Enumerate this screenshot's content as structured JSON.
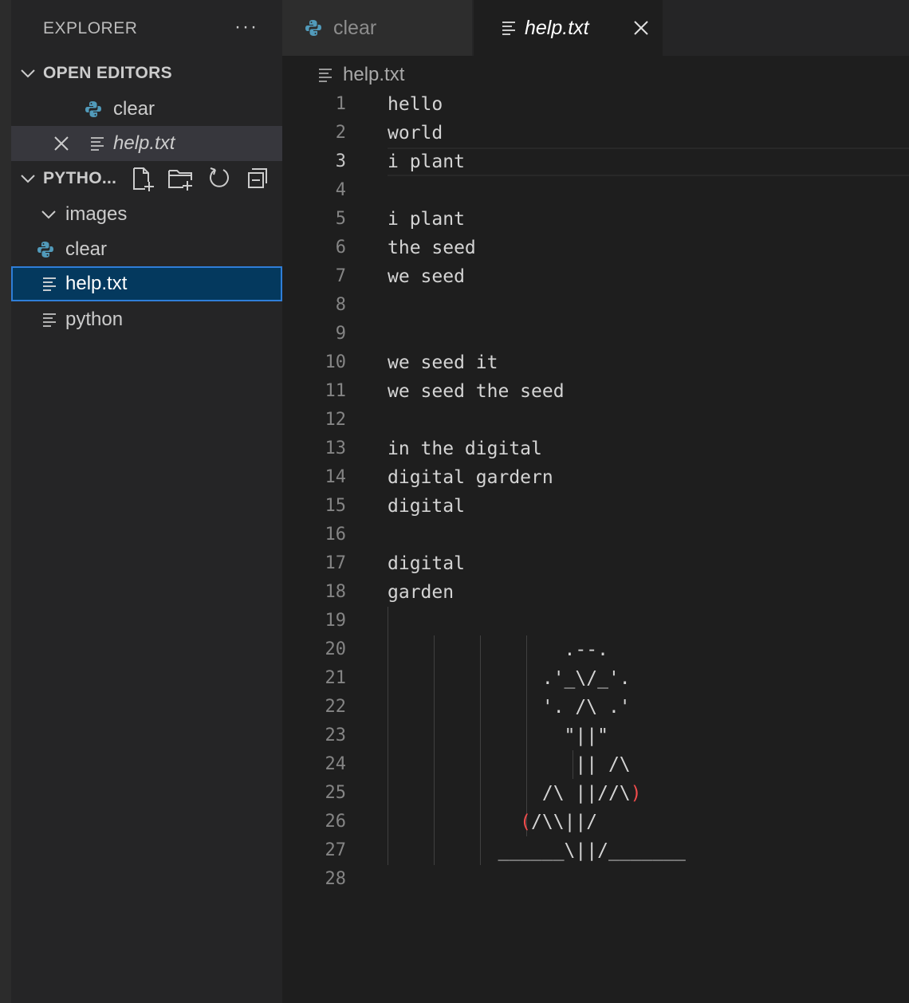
{
  "sidebar": {
    "title": "EXPLORER",
    "more_label": "···",
    "open_editors": {
      "title": "OPEN EDITORS",
      "items": [
        {
          "label": "clear",
          "icon": "python-icon"
        },
        {
          "label": "help.txt",
          "icon": "text-file-icon"
        }
      ]
    },
    "project": {
      "title": "PYTHO...",
      "items": [
        {
          "label": "images",
          "icon": "chevron-down-icon"
        },
        {
          "label": "clear",
          "icon": "python-icon"
        },
        {
          "label": "help.txt",
          "icon": "text-file-icon"
        },
        {
          "label": "python",
          "icon": "text-file-icon"
        }
      ]
    }
  },
  "tabs": [
    {
      "label": "clear",
      "icon": "python-icon",
      "active": false
    },
    {
      "label": "help.txt",
      "icon": "text-file-icon",
      "active": true
    }
  ],
  "breadcrumb": "help.txt",
  "colors": {
    "python_icon": "#519aba",
    "selection_bg": "#04395e",
    "selection_border": "#2f7ed8",
    "bracket_red": "#f14c4c"
  },
  "editor": {
    "current_line": 3,
    "lines": [
      {
        "n": "1",
        "text": "hello"
      },
      {
        "n": "2",
        "text": "world"
      },
      {
        "n": "3",
        "text": "i plant"
      },
      {
        "n": "4",
        "text": ""
      },
      {
        "n": "5",
        "text": "i plant"
      },
      {
        "n": "6",
        "text": "the seed"
      },
      {
        "n": "7",
        "text": "we seed"
      },
      {
        "n": "8",
        "text": ""
      },
      {
        "n": "9",
        "text": ""
      },
      {
        "n": "10",
        "text": "we seed it"
      },
      {
        "n": "11",
        "text": "we seed the seed"
      },
      {
        "n": "12",
        "text": ""
      },
      {
        "n": "13",
        "text": "in the digital"
      },
      {
        "n": "14",
        "text": "digital gardern"
      },
      {
        "n": "15",
        "text": "digital"
      },
      {
        "n": "16",
        "text": ""
      },
      {
        "n": "17",
        "text": "digital"
      },
      {
        "n": "18",
        "text": "garden"
      },
      {
        "n": "19",
        "text": ""
      },
      {
        "n": "20",
        "text": "                .--."
      },
      {
        "n": "21",
        "text": "              .'_\\/_'."
      },
      {
        "n": "22",
        "text": "              '. /\\ .'"
      },
      {
        "n": "23",
        "text": "                \"||\""
      },
      {
        "n": "24",
        "text": "                 || /\\"
      },
      {
        "n": "25",
        "parts": [
          "              /\\ ||//\\",
          ")"
        ]
      },
      {
        "n": "26",
        "parts": [
          "            ",
          "(",
          "/\\\\||/"
        ]
      },
      {
        "n": "27",
        "text": "          ______\\||/_______"
      },
      {
        "n": "28",
        "text": ""
      }
    ]
  }
}
